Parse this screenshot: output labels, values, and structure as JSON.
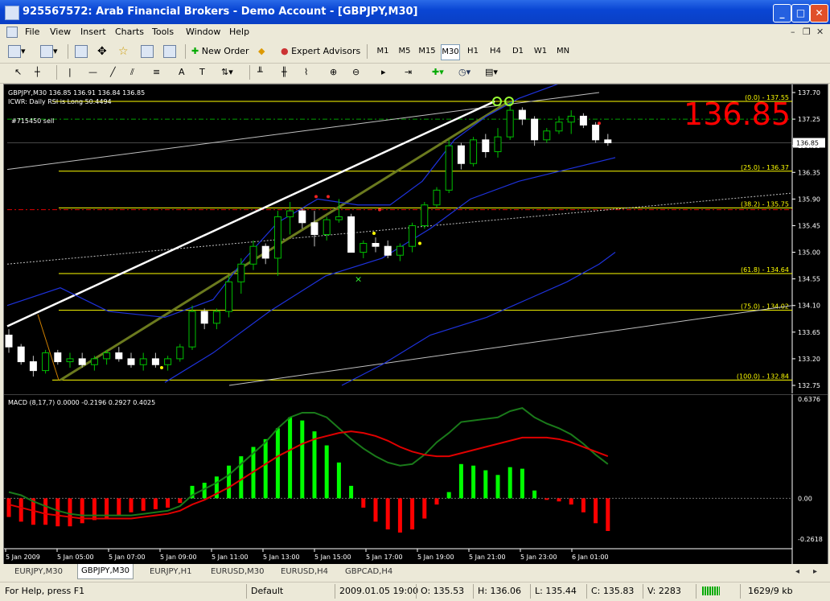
{
  "window": {
    "title": "925567572: Arab Financial Brokers - Demo Account - [GBPJPY,M30]"
  },
  "menu": [
    "File",
    "View",
    "Insert",
    "Charts",
    "Tools",
    "Window",
    "Help"
  ],
  "toolbar": {
    "new_order": "New Order",
    "expert_advisors": "Expert Advisors"
  },
  "timeframes": [
    "M1",
    "M5",
    "M15",
    "M30",
    "H1",
    "H4",
    "D1",
    "W1",
    "MN"
  ],
  "active_timeframe": "M30",
  "chart": {
    "header": "GBPJPY,M30  136.85 136.91 136.84 136.85",
    "indicator_label": "ICWR: Daily RSI is Long 50.4494",
    "order_label": "#715450 sell",
    "big_price": "136.85",
    "current_price": "136.85",
    "price_axis": [
      "137.70",
      "137.25",
      "136.80",
      "136.35",
      "135.90",
      "135.45",
      "135.00",
      "134.55",
      "134.10",
      "133.65",
      "133.20",
      "132.75"
    ],
    "fib_labels": [
      "(0.0) - 137.55",
      "(25.0) - 136.37",
      "(38.2) - 135.75",
      "(61.8) - 134.64",
      "(75.0) - 134.02",
      "(100.0) - 132.84"
    ],
    "macd_label": "MACD  (8,17,7)  0.0000  -0.2196  0.2927  0.4025",
    "macd_axis": [
      "0.6376",
      "0.00",
      "-0.2618"
    ],
    "time_axis": [
      "5 Jan 2009",
      "5 Jan 05:00",
      "5 Jan 07:00",
      "5 Jan 09:00",
      "5 Jan 11:00",
      "5 Jan 13:00",
      "5 Jan 15:00",
      "5 Jan 17:00",
      "5 Jan 19:00",
      "5 Jan 21:00",
      "5 Jan 23:00",
      "6 Jan 01:00"
    ],
    "colors": {
      "bull": "#00c000",
      "bear": "#ffffff",
      "fib": "#ffff00",
      "macd_up": "#00ff00",
      "macd_down": "#ff0000",
      "big_price": "#ff0000"
    }
  },
  "tabs": [
    "EURJPY,M30",
    "GBPJPY,M30",
    "EURJPY,H1",
    "EURUSD,M30",
    "EURUSD,H4",
    "GBPCAD,H4"
  ],
  "active_tab": "GBPJPY,M30",
  "status": {
    "help": "For Help, press F1",
    "profile": "Default",
    "datetime": "2009.01.05 19:00",
    "open": "O: 135.53",
    "high": "H: 136.06",
    "low": "L: 135.44",
    "close": "C: 135.83",
    "volume": "V: 2283",
    "traffic": "1629/9 kb"
  },
  "chart_data": {
    "type": "candlestick",
    "symbol": "GBPJPY",
    "timeframe": "M30",
    "ylim": [
      132.75,
      137.7
    ],
    "candles": [
      [
        133.6,
        133.7,
        133.3,
        133.4
      ],
      [
        133.4,
        133.45,
        133.1,
        133.15
      ],
      [
        133.15,
        133.25,
        132.9,
        133.0
      ],
      [
        133.0,
        133.35,
        132.95,
        133.3
      ],
      [
        133.3,
        133.35,
        133.1,
        133.15
      ],
      [
        133.15,
        133.3,
        133.05,
        133.2
      ],
      [
        133.2,
        133.3,
        133.05,
        133.1
      ],
      [
        133.1,
        133.25,
        133.0,
        133.2
      ],
      [
        133.2,
        133.35,
        133.1,
        133.3
      ],
      [
        133.3,
        133.4,
        133.15,
        133.2
      ],
      [
        133.2,
        133.3,
        133.05,
        133.1
      ],
      [
        133.1,
        133.3,
        133.0,
        133.2
      ],
      [
        133.2,
        133.3,
        133.05,
        133.1
      ],
      [
        133.1,
        133.25,
        133.0,
        133.2
      ],
      [
        133.2,
        133.45,
        133.15,
        133.4
      ],
      [
        133.4,
        134.1,
        133.35,
        134.0
      ],
      [
        134.0,
        134.05,
        133.7,
        133.8
      ],
      [
        133.8,
        134.05,
        133.7,
        134.0
      ],
      [
        134.0,
        134.6,
        133.9,
        134.5
      ],
      [
        134.5,
        134.9,
        134.3,
        134.8
      ],
      [
        134.8,
        135.2,
        134.7,
        135.1
      ],
      [
        135.1,
        135.15,
        134.8,
        134.9
      ],
      [
        134.9,
        135.7,
        134.6,
        135.6
      ],
      [
        135.6,
        135.85,
        135.3,
        135.7
      ],
      [
        135.7,
        135.75,
        135.4,
        135.5
      ],
      [
        135.5,
        135.7,
        135.1,
        135.3
      ],
      [
        135.3,
        135.6,
        135.2,
        135.55
      ],
      [
        135.55,
        135.9,
        135.5,
        135.6
      ],
      [
        135.6,
        135.65,
        135.0,
        135.0
      ],
      [
        135.0,
        135.2,
        134.9,
        135.15
      ],
      [
        135.15,
        135.25,
        135.0,
        135.1
      ],
      [
        135.1,
        135.2,
        134.9,
        134.95
      ],
      [
        134.95,
        135.15,
        134.85,
        135.1
      ],
      [
        135.1,
        135.5,
        135.0,
        135.45
      ],
      [
        135.45,
        135.85,
        135.4,
        135.8
      ],
      [
        135.8,
        136.1,
        135.75,
        136.05
      ],
      [
        136.05,
        136.9,
        136.0,
        136.8
      ],
      [
        136.8,
        136.85,
        136.4,
        136.5
      ],
      [
        136.5,
        136.95,
        136.45,
        136.9
      ],
      [
        136.9,
        137.0,
        136.6,
        136.7
      ],
      [
        136.7,
        137.1,
        136.6,
        136.95
      ],
      [
        136.95,
        137.55,
        136.9,
        137.4
      ],
      [
        137.4,
        137.45,
        137.15,
        137.25
      ],
      [
        137.25,
        137.3,
        136.8,
        136.9
      ],
      [
        136.9,
        137.1,
        136.85,
        137.05
      ],
      [
        137.05,
        137.3,
        137.0,
        137.2
      ],
      [
        137.2,
        137.4,
        137.0,
        137.3
      ],
      [
        137.3,
        137.35,
        137.1,
        137.15
      ],
      [
        137.15,
        137.2,
        136.85,
        136.9
      ],
      [
        136.9,
        137.0,
        136.8,
        136.85
      ]
    ],
    "macd_histogram": [
      -0.12,
      -0.15,
      -0.17,
      -0.17,
      -0.18,
      -0.18,
      -0.16,
      -0.14,
      -0.13,
      -0.11,
      -0.09,
      -0.08,
      -0.07,
      -0.06,
      -0.03,
      0.08,
      0.1,
      0.14,
      0.21,
      0.27,
      0.33,
      0.38,
      0.45,
      0.52,
      0.5,
      0.43,
      0.34,
      0.23,
      0.08,
      -0.06,
      -0.15,
      -0.2,
      -0.22,
      -0.2,
      -0.13,
      -0.04,
      0.04,
      0.22,
      0.21,
      0.18,
      0.15,
      0.2,
      0.19,
      0.05,
      -0.01,
      -0.02,
      -0.04,
      -0.09,
      -0.16,
      -0.21
    ],
    "macd_signal": [
      -0.04,
      -0.06,
      -0.08,
      -0.1,
      -0.11,
      -0.12,
      -0.13,
      -0.13,
      -0.13,
      -0.13,
      -0.13,
      -0.12,
      -0.11,
      -0.1,
      -0.08,
      -0.04,
      -0.01,
      0.03,
      0.07,
      0.12,
      0.17,
      0.22,
      0.27,
      0.31,
      0.35,
      0.38,
      0.4,
      0.42,
      0.43,
      0.42,
      0.4,
      0.37,
      0.33,
      0.3,
      0.28,
      0.27,
      0.27,
      0.29,
      0.31,
      0.33,
      0.35,
      0.37,
      0.39,
      0.39,
      0.39,
      0.38,
      0.36,
      0.33,
      0.3,
      0.27
    ],
    "macd_main": [
      0.04,
      0.02,
      -0.02,
      -0.05,
      -0.08,
      -0.1,
      -0.11,
      -0.11,
      -0.11,
      -0.11,
      -0.11,
      -0.1,
      -0.09,
      -0.08,
      -0.05,
      0.02,
      0.06,
      0.1,
      0.15,
      0.22,
      0.29,
      0.36,
      0.45,
      0.52,
      0.55,
      0.55,
      0.52,
      0.45,
      0.38,
      0.32,
      0.27,
      0.23,
      0.21,
      0.22,
      0.28,
      0.36,
      0.42,
      0.49,
      0.5,
      0.51,
      0.52,
      0.56,
      0.58,
      0.52,
      0.48,
      0.45,
      0.41,
      0.35,
      0.28,
      0.22
    ]
  }
}
